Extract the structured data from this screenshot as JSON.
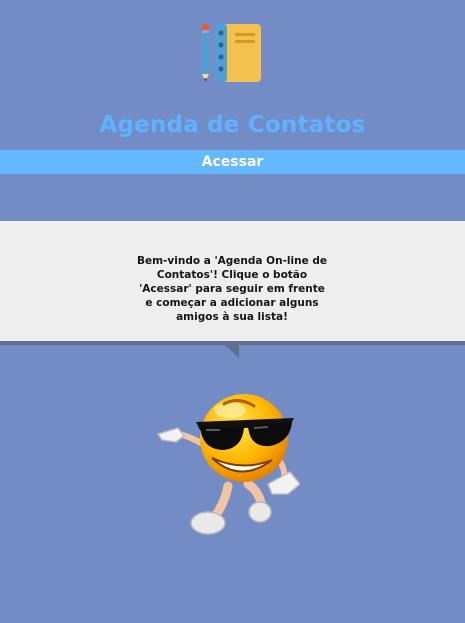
{
  "header": {
    "logo_icon": "notebook-pencil-icon",
    "title": "Agenda de Contatos"
  },
  "actions": {
    "access_label": "Acessar"
  },
  "welcome": {
    "message": "Bem-vindo a 'Agenda On-line de Contatos'! Clique o botão 'Acessar' para seguir em frente e começar a adicionar alguns amigos à sua lista!"
  },
  "mascot": {
    "icon": "cool-smiley-sunglasses-icon"
  },
  "colors": {
    "background": "#738cc6",
    "title": "#5eb3ff",
    "button": "#63b8ff",
    "bubble": "#eeeeee"
  }
}
